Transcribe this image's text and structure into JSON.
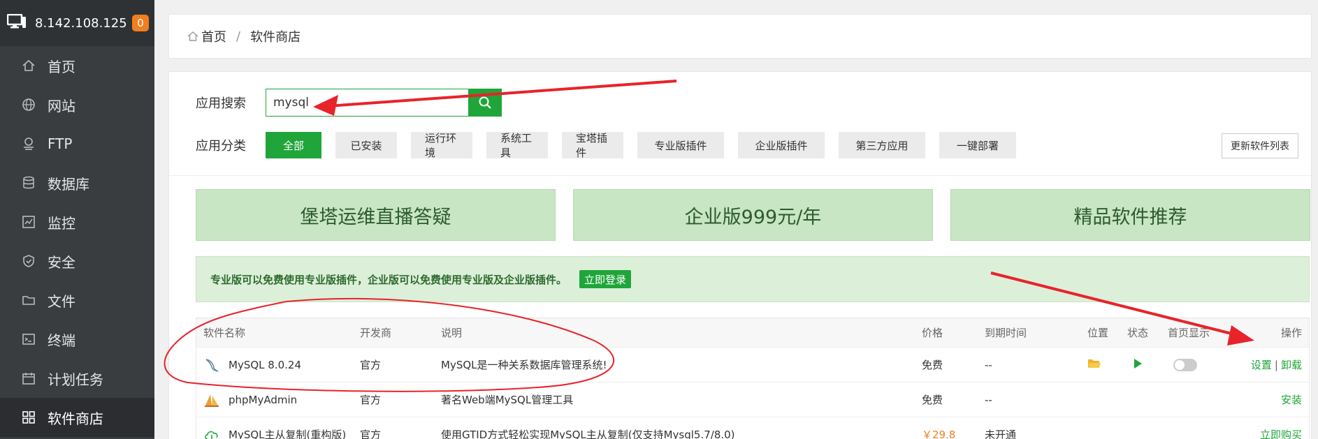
{
  "sidebar": {
    "server_ip": "8.142.108.125",
    "badge": "0",
    "items": [
      {
        "label": "首页",
        "icon": "home-icon"
      },
      {
        "label": "网站",
        "icon": "globe-icon"
      },
      {
        "label": "FTP",
        "icon": "ftp-icon"
      },
      {
        "label": "数据库",
        "icon": "database-icon"
      },
      {
        "label": "监控",
        "icon": "monitor-icon"
      },
      {
        "label": "安全",
        "icon": "shield-icon"
      },
      {
        "label": "文件",
        "icon": "folder-icon"
      },
      {
        "label": "终端",
        "icon": "terminal-icon"
      },
      {
        "label": "计划任务",
        "icon": "calendar-icon"
      },
      {
        "label": "软件商店",
        "icon": "grid-icon"
      }
    ]
  },
  "breadcrumb": {
    "home": "首页",
    "sep": "/",
    "current": "软件商店"
  },
  "search": {
    "label": "应用搜索",
    "value": "mysql"
  },
  "categories": {
    "label": "应用分类",
    "items": [
      "全部",
      "已安装",
      "运行环境",
      "系统工具",
      "宝塔插件",
      "专业版插件",
      "企业版插件",
      "第三方应用",
      "一键部署"
    ],
    "refresh": "更新软件列表"
  },
  "banners": [
    "堡塔运维直播答疑",
    "企业版999元/年",
    "精品软件推荐"
  ],
  "notice": {
    "text": "专业版可以免费使用专业版插件，企业版可以免费使用专业版及企业版插件。",
    "button": "立即登录"
  },
  "table": {
    "headers": {
      "name": "软件名称",
      "dev": "开发商",
      "desc": "说明",
      "price": "价格",
      "expire": "到期时间",
      "pos": "位置",
      "state": "状态",
      "home": "首页显示",
      "op": "操作"
    },
    "rows": [
      {
        "name": "MySQL 8.0.24",
        "dev": "官方",
        "desc": "MySQL是一种关系数据库管理系统!",
        "price": "免费",
        "expire": "--",
        "op1": "设置",
        "pipe": "|",
        "op2": "卸载"
      },
      {
        "name": "phpMyAdmin",
        "dev": "官方",
        "desc": "著名Web端MySQL管理工具",
        "price": "免费",
        "expire": "--",
        "op1": "安装"
      },
      {
        "name": "MySQL主从复制(重构版)",
        "dev": "官方",
        "desc": "使用GTID方式轻松实现MySQL主从复制(仅支持Mysql5.7/8.0)",
        "price": "￥29.8",
        "expire": "未开通",
        "op1": "立即购买"
      }
    ]
  },
  "colors": {
    "accent": "#20a53a",
    "sidebar": "#3a3d40",
    "annotation": "#e8232a"
  }
}
